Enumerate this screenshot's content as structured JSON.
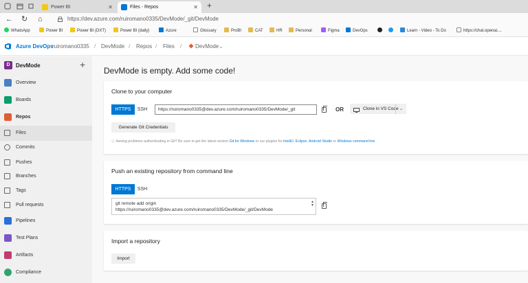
{
  "browser": {
    "tabs": [
      {
        "title": "Power BI",
        "active": false,
        "favicon_color": "#f2c811"
      },
      {
        "title": "Files - Repos",
        "active": true,
        "favicon_color": "#0078d4"
      }
    ],
    "new_tab": "+",
    "url": "https://dev.azure.com/ruiromano0335/DevMode/_git/DevMode",
    "bookmarks": [
      {
        "label": "WhatsApp",
        "color": "#25d366"
      },
      {
        "label": "Power BI",
        "color": "#f2c811"
      },
      {
        "label": "Power BI (DXT)",
        "color": "#f2c811"
      },
      {
        "label": "Power BI (daily)",
        "color": "#f2c811"
      },
      {
        "label": "Azure",
        "color": "#0078d4"
      },
      {
        "label": "Glossary",
        "color": "#888888"
      },
      {
        "label": "ProBI",
        "color": "#e8b84a"
      },
      {
        "label": "CAT",
        "color": "#e8b84a"
      },
      {
        "label": "HR",
        "color": "#e8b84a"
      },
      {
        "label": "Personal",
        "color": "#e8b84a"
      },
      {
        "label": "Figma",
        "color": "#a259ff"
      },
      {
        "label": "DevOps",
        "color": "#0078d4"
      },
      {
        "label": "",
        "color": "#222222"
      },
      {
        "label": "",
        "color": "#1d9bf0"
      },
      {
        "label": "Learn - Video - To Do",
        "color": "#2b88d8"
      },
      {
        "label": "https://chat.openai....",
        "color": "#888888"
      }
    ]
  },
  "ado_header": {
    "product": "Azure DevOps",
    "breadcrumbs": [
      "ruiromano0335",
      "DevMode",
      "Repos",
      "Files",
      "DevMode"
    ]
  },
  "sidebar": {
    "project_initial": "D",
    "project_name": "DevMode",
    "add": "+",
    "items": [
      {
        "label": "Overview",
        "color": "#4a7fc1"
      },
      {
        "label": "Boards",
        "color": "#0a9e6b"
      },
      {
        "label": "Repos",
        "color": "#e05d36"
      },
      {
        "label": "Files",
        "color": ""
      },
      {
        "label": "Commits",
        "color": ""
      },
      {
        "label": "Pushes",
        "color": ""
      },
      {
        "label": "Branches",
        "color": ""
      },
      {
        "label": "Tags",
        "color": ""
      },
      {
        "label": "Pull requests",
        "color": ""
      },
      {
        "label": "Pipelines",
        "color": "#2b6fd6"
      },
      {
        "label": "Test Plans",
        "color": "#7b57c6"
      },
      {
        "label": "Artifacts",
        "color": "#c23b6f"
      },
      {
        "label": "Compliance",
        "color": "#2fa56b"
      }
    ]
  },
  "main": {
    "title": "DevMode is empty. Add some code!",
    "clone": {
      "title": "Clone to your computer",
      "https": "HTTPS",
      "ssh": "SSH",
      "url": "https://ruiromano0335@dev.azure.com/ruiromano0335/DevMode/_git",
      "or": "OR",
      "clone_vscode": "Clone in VS Code",
      "generate": "Generate Git Credentials",
      "note_prefix": "Having problems authenticating in Git? Be sure to get the latest version",
      "note_git_windows": "Git for Windows",
      "note_mid": "or our plugins for",
      "note_intellij": "IntelliJ",
      "note_eclipse": "Eclipse",
      "note_android": "Android Studio",
      "note_or": "or",
      "note_cmd": "Windows command line"
    },
    "push": {
      "title": "Push an existing repository from command line",
      "https": "HTTPS",
      "ssh": "SSH",
      "line1": "git remote add origin",
      "line2": "https://ruiromano0335@dev.azure.com/ruiromano0335/DevMode/_git/DevMode"
    },
    "import": {
      "title": "Import a repository",
      "button": "Import"
    }
  }
}
